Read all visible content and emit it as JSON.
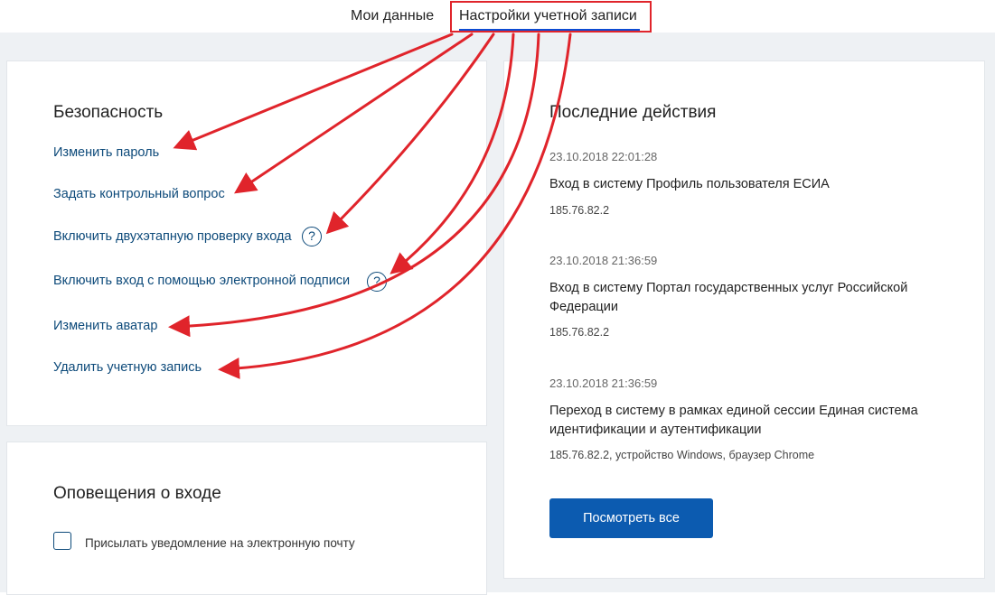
{
  "tabs": {
    "my_data": "Мои данные",
    "account_settings": "Настройки учетной записи"
  },
  "security": {
    "title": "Безопасность",
    "links": [
      "Изменить пароль",
      "Задать контрольный вопрос",
      "Включить двухэтапную проверку входа",
      "Включить вход с помощью электронной подписи",
      "Изменить аватар",
      "Удалить учетную запись"
    ],
    "help_glyph": "?"
  },
  "notifications": {
    "title": "Оповещения о входе",
    "email_checkbox_label": "Присылать уведомление на электронную почту",
    "email_checkbox_checked": false
  },
  "recent_actions": {
    "title": "Последние действия",
    "items": [
      {
        "date": "23.10.2018 22:01:28",
        "action": "Вход в систему Профиль пользователя ЕСИА",
        "details": "185.76.82.2"
      },
      {
        "date": "23.10.2018 21:36:59",
        "action": "Вход в систему Портал государственных услуг Российской Федерации",
        "details": "185.76.82.2"
      },
      {
        "date": "23.10.2018 21:36:59",
        "action": "Переход в систему в рамках единой сессии Единая система идентификации и аутентификации",
        "details": "185.76.82.2, устройство Windows, браузер Chrome"
      }
    ],
    "view_all_button": "Посмотреть все"
  },
  "colors": {
    "annotation": "#e0242b",
    "link": "#0d4a7a",
    "primary_button": "#0c5bb0",
    "page_background": "#eef1f4"
  },
  "icons": {
    "help": "question-circle-icon",
    "annotation_arrow": "red-arrow-icon"
  }
}
